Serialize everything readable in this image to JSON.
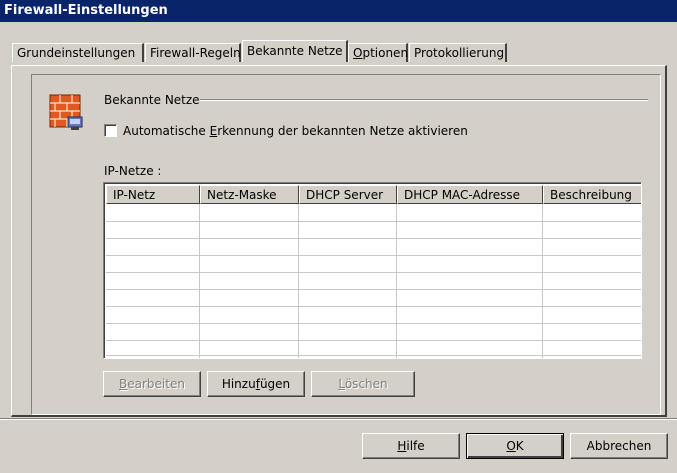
{
  "window": {
    "title": "Firewall-Einstellungen"
  },
  "tabs": [
    {
      "label": "Grundeinstellungen",
      "active": false
    },
    {
      "label": "Firewall-Regeln",
      "active": false
    },
    {
      "label": "Bekannte Netze",
      "active": true
    },
    {
      "label": "Optionen",
      "access_key": "O",
      "active": false
    },
    {
      "label": "Protokollierung",
      "active": false
    }
  ],
  "group": {
    "title": "Bekannte Netze",
    "icon": "firewall-wall-icon"
  },
  "checkbox": {
    "label_pre": "Automatische ",
    "label_key": "E",
    "label_post": "rkennung der bekannten Netze aktivieren",
    "checked": false
  },
  "table": {
    "label": "IP-Netze :",
    "columns": [
      "IP-Netz",
      "Netz-Maske",
      "DHCP Server",
      "DHCP MAC-Adresse",
      "Beschreibung"
    ],
    "rows": []
  },
  "table_buttons": {
    "edit": {
      "key": "B",
      "rest": "earbeiten",
      "enabled": false
    },
    "add": {
      "pre": "Hinzu",
      "key": "f",
      "post": "ügen",
      "enabled": true
    },
    "delete": {
      "key": "L",
      "rest": "öschen",
      "enabled": false
    }
  },
  "dialog_buttons": {
    "help": {
      "key": "H",
      "rest": "ilfe"
    },
    "ok": {
      "key": "O",
      "rest": "K"
    },
    "cancel": {
      "label": "Abbrechen"
    }
  },
  "colors": {
    "titlebar": "#0a246a",
    "face": "#d4d0c8",
    "disabled_text": "#808080"
  }
}
